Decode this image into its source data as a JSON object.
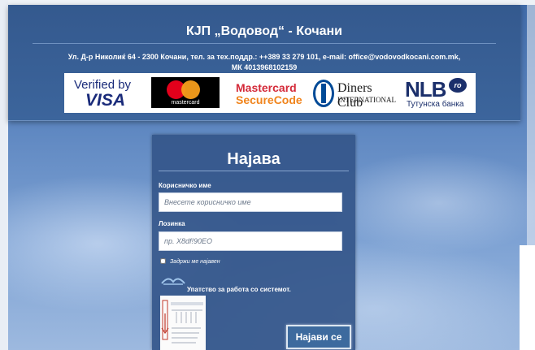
{
  "header": {
    "company_title": "КЈП „Водовод“ - Кочани",
    "address_line1": "Ул. Д-р Николиќ 64 - 2300 Кочани, тел. за тех.поддр.: ++389 33 279 101, e-mail: office@vodovodkocani.com.mk,",
    "address_line2": "МК 4013968102159"
  },
  "card_logos": {
    "visa_top": "Verified by",
    "visa_bottom": "VISA",
    "mastercard": "mastercard",
    "securecode_line1": "Mastercard",
    "securecode_line2": "SecureCode",
    "diners_line1": "Diners Club",
    "diners_line2": "INTERNATIONAL",
    "nlb_name": "NLB",
    "nlb_badge": "ro",
    "nlb_bank": "Тутунска банка"
  },
  "login": {
    "title": "Најава",
    "username_label": "Корисничко име",
    "username_placeholder": "Внесете корисничко име",
    "username_value": "",
    "password_label": "Лозинка",
    "password_placeholder": "пр. X8df!90EO",
    "password_value": "",
    "remember_label": "Задржи ме најавен",
    "remember_checked": false,
    "manual_text": "Упатство за работа со системот.",
    "submit_label": "Најави се"
  },
  "colors": {
    "header_bg": "#34598e",
    "panel_bg": "#34568a",
    "button_bg": "#3d6a9e"
  }
}
